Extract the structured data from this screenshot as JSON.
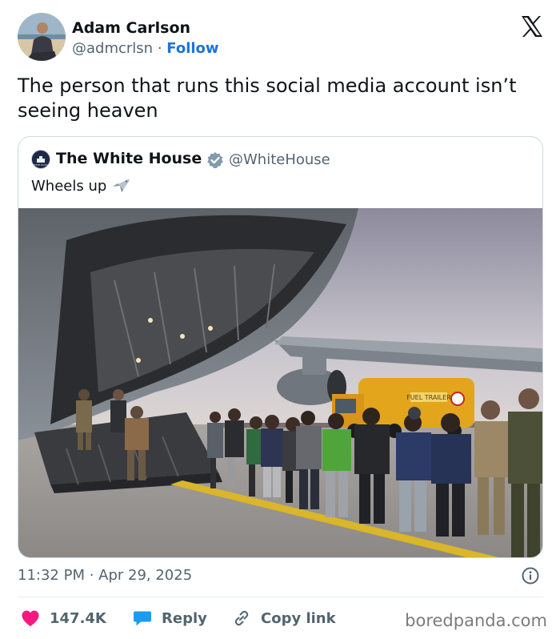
{
  "author": {
    "name": "Adam Carlson",
    "handle": "@admcrlsn",
    "separator": "·",
    "follow_label": "Follow"
  },
  "tweet": {
    "text": "The person that runs this social media account isn’t seeing heaven",
    "timestamp": "11:32 PM · Apr 29, 2025"
  },
  "quoted_tweet": {
    "name": "The White House",
    "handle": "@WhiteHouse",
    "text": "Wheels up",
    "avatar_text": "WHITE HOUSE",
    "truck_label": "FUEL TRAILER"
  },
  "actions": {
    "likes": "147.4K",
    "reply_label": "Reply",
    "copy_link_label": "Copy link"
  },
  "watermark": "boredpanda.com",
  "colors": {
    "link": "#1d73d8",
    "like": "#f91880",
    "reply": "#1d9bf0",
    "verified": "#829aab",
    "muted": "#536471"
  },
  "icons": {
    "brand": "x-logo-icon",
    "verified": "verified-badge-icon",
    "plane": "airplane-emoji-icon",
    "info": "info-icon",
    "like": "heart-icon",
    "reply": "speech-bubble-icon",
    "copy": "link-icon"
  }
}
